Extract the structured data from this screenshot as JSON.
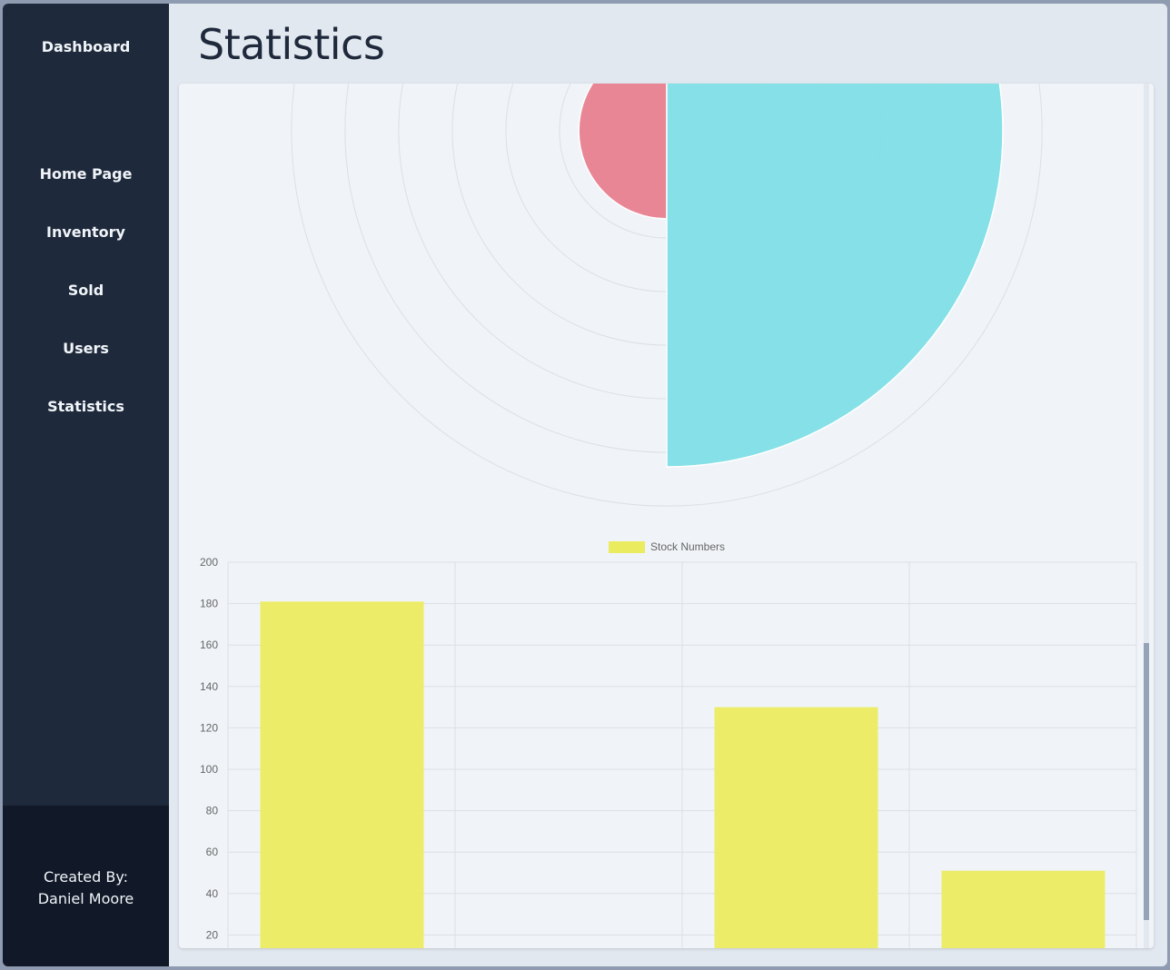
{
  "sidebar": {
    "brand": "Dashboard",
    "items": [
      {
        "label": "Home Page"
      },
      {
        "label": "Inventory"
      },
      {
        "label": "Sold"
      },
      {
        "label": "Users"
      },
      {
        "label": "Statistics"
      }
    ],
    "footer": {
      "line1": "Created By:",
      "line2": "Daniel Moore"
    }
  },
  "page": {
    "title": "Statistics"
  },
  "colors": {
    "sidebar_bg": "#1e293b",
    "footer_bg": "#111827",
    "polar_red": "#e8808f",
    "polar_cyan": "#7fdee6",
    "bar_yellow": "#ebeb60"
  },
  "chart_data": [
    {
      "type": "polarArea",
      "values": [
        55,
        210
      ],
      "colors": [
        "#e8808f",
        "#7fdee6"
      ],
      "grid": true
    },
    {
      "type": "bar",
      "categories": [
        "",
        "",
        "",
        ""
      ],
      "series": [
        {
          "name": "Stock Numbers",
          "values": [
            181,
            0,
            130,
            51
          ]
        }
      ],
      "y_ticks": [
        200,
        180,
        160,
        140,
        120,
        100,
        80,
        60,
        40,
        20
      ],
      "ylim": [
        0,
        200
      ],
      "legend": "top",
      "grid": true
    }
  ]
}
